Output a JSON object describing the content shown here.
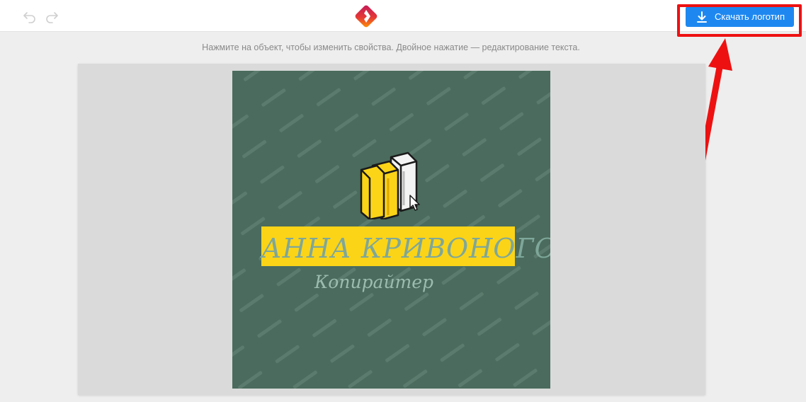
{
  "toolbar": {
    "download_label": "Скачать логотип"
  },
  "hint": {
    "text": "Нажмите на объект, чтобы изменить свойства. Двойное нажатие — редактирование текста."
  },
  "logo": {
    "name": "АННА КРИВОНОГОВА",
    "subtitle": "Копирайтер",
    "background_color": "#4a6b5d",
    "accent_color": "#fbd418"
  },
  "icons": {
    "undo": "undo-icon",
    "redo": "redo-icon",
    "download": "download-icon",
    "app": "app-logo-icon",
    "books": "books-icon"
  },
  "colors": {
    "primary_button": "#1e88f0",
    "annotation": "#ee1111"
  }
}
